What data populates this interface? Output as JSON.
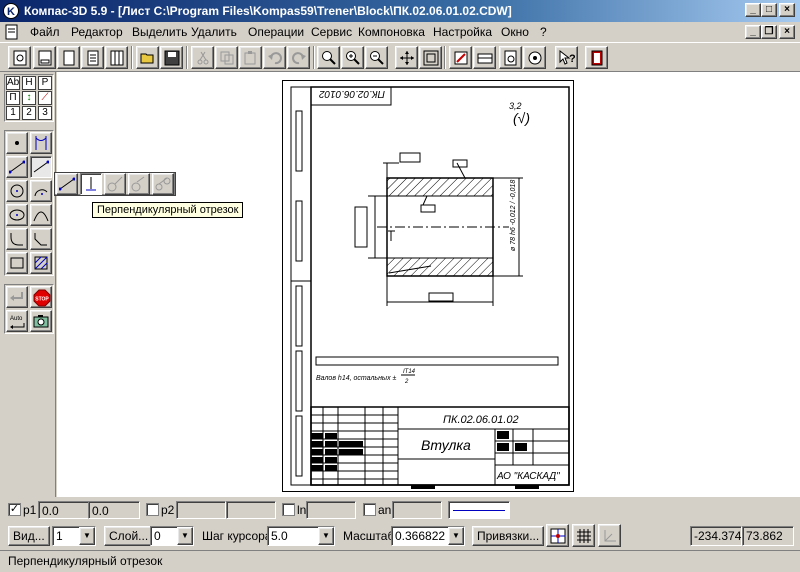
{
  "window": {
    "title": "Компас-3D 5.9 - [Лист C:\\Program Files\\Kompas59\\Trener\\Block\\ПК.02.06.01.02.CDW]"
  },
  "menu": {
    "items": [
      "Файл",
      "Редактор",
      "Выделить",
      "Удалить",
      "Операции",
      "Сервис",
      "Компоновка",
      "Настройка",
      "Окно",
      "?"
    ]
  },
  "left_panel": {
    "tabs": [
      "Ab",
      "H",
      "P",
      "П",
      "",
      "",
      "1",
      "2",
      "3"
    ],
    "auto_label": "Auto",
    "stop_label": "STOP"
  },
  "tooltip": "Перпендикулярный отрезок",
  "drawing": {
    "designation": "ПК.02.06.01.02",
    "designation_rotated": "ПК.02.06.0102",
    "part_name": "Втулка",
    "company": "АО \"КАСКАД\"",
    "roughness_value": "3,2",
    "roughness_symbol": "(√)",
    "note": "Валов h14, остальных ±",
    "note_fraction_top": "IT14",
    "note_fraction_bottom": "2",
    "dim_vertical": "ø 78 h6 -0,012 / -0,018"
  },
  "params": {
    "p1_label": "p1",
    "p1_x": "0.0",
    "p1_y": "0.0",
    "p2_label": "p2",
    "ln_label": "ln",
    "an_label": "an"
  },
  "bottom": {
    "view_btn": "Вид...",
    "view_value": "1",
    "layer_btn": "Слой...",
    "layer_value": "0",
    "step_label": "Шаг курсора",
    "step_value": "5.0",
    "scale_label": "Масштаб",
    "scale_value": "0.366822",
    "snap_btn": "Привязки...",
    "coord_x": "-234.374",
    "coord_y": "73.862"
  },
  "status": {
    "text": "Перпендикулярный отрезок"
  }
}
